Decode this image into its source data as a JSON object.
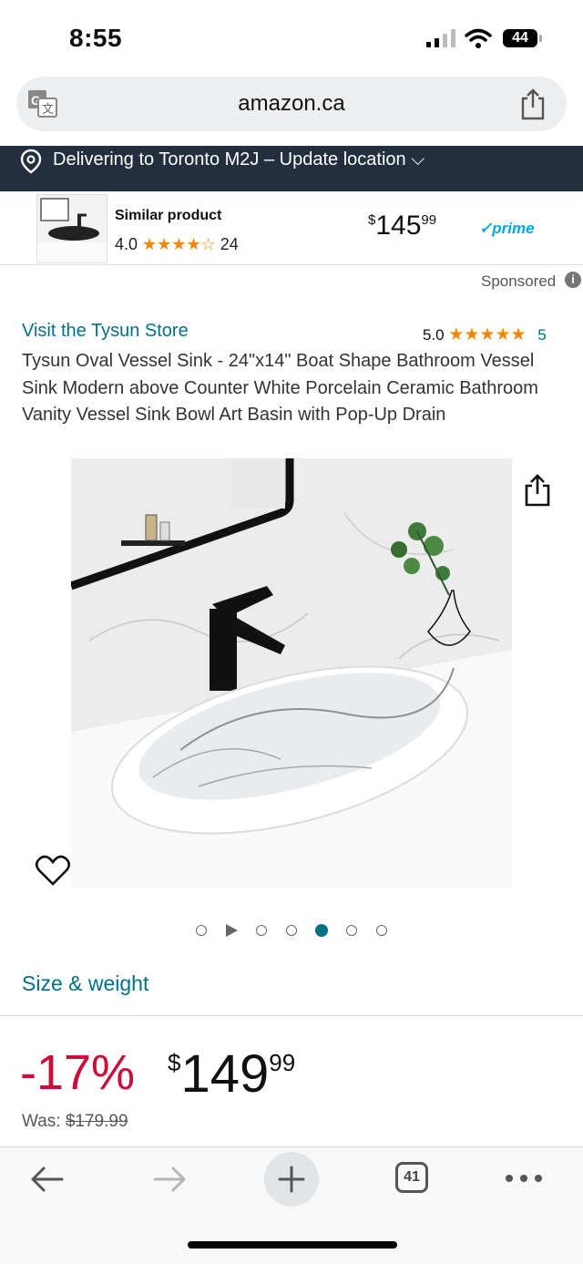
{
  "status_bar": {
    "time": "8:55",
    "battery": "44"
  },
  "browser": {
    "url": "amazon.ca"
  },
  "delivery": {
    "text": "Delivering to Toronto M2J – Update location ⌵"
  },
  "sponsored_product": {
    "label": "Similar product",
    "rating": "4.0",
    "stars": "★★★★☆",
    "review_count": "24",
    "price_symbol": "$",
    "price_whole": "145",
    "price_fraction": "99",
    "prime_label": "✓prime",
    "sponsored_label": "Sponsored",
    "info_label": "i"
  },
  "product": {
    "store_link": "Visit the Tysun Store",
    "rating": "5.0",
    "stars": "★★★★★",
    "rating_count": "5",
    "title": "Tysun Oval Vessel Sink - 24\"x14\" Boat Shape Bathroom Vessel Sink Modern above Counter White Porcelain Ceramic Bathroom Vanity Vessel Sink Bowl Art Basin with Pop-Up Drain",
    "carousel": {
      "total": 7,
      "active_index": 4
    },
    "size_weight_link": "Size & weight",
    "discount": "-17%",
    "price_symbol": "$",
    "price_whole": "149",
    "price_fraction": "99",
    "was_label": "Was:",
    "was_price": "$179.99"
  },
  "toolbar": {
    "tabs_count": "41"
  },
  "colors": {
    "link": "#007185",
    "delivery_bg": "#232f3e",
    "discount": "#cc0c39",
    "star": "#f08804",
    "prime": "#00a8e1"
  }
}
